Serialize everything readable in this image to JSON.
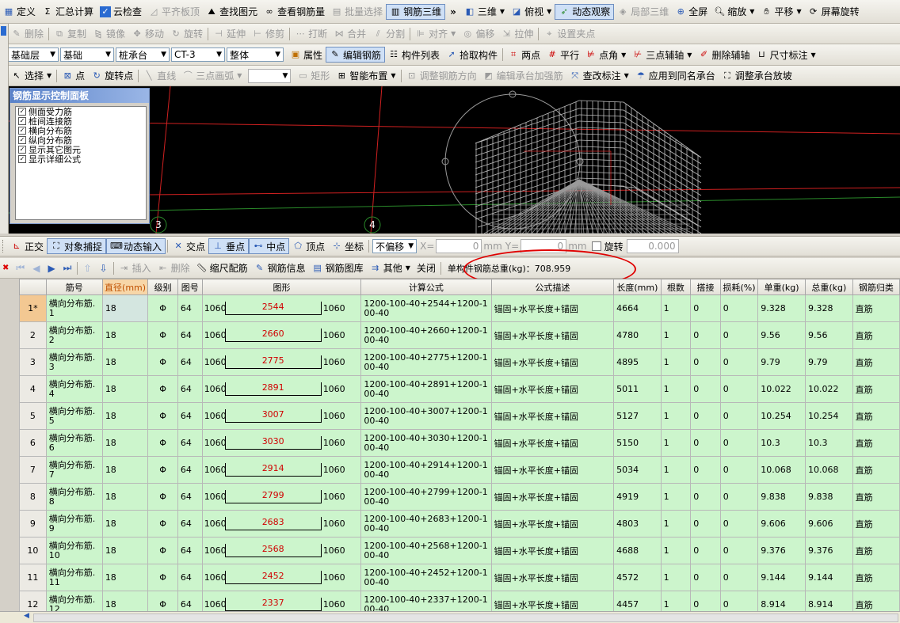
{
  "menu": {
    "items": [
      "定义",
      "汇总计算",
      "云检查",
      "平齐板顶",
      "查找图元",
      "查看钢筋量",
      "批量选择",
      "钢筋三维",
      "三维",
      "俯视",
      "动态观察",
      "局部三维",
      "全屏",
      "缩放",
      "平移",
      "屏幕旋转"
    ]
  },
  "edit_toolbar": {
    "items": [
      "删除",
      "复制",
      "镜像",
      "移动",
      "旋转",
      "延伸",
      "修剪",
      "打断",
      "合并",
      "分割",
      "对齐",
      "偏移",
      "拉伸",
      "设置夹点"
    ]
  },
  "props_toolbar": {
    "layer": "基础层",
    "category": "基础",
    "type": "桩承台",
    "element": "CT-3",
    "scope": "整体",
    "items": [
      "属性",
      "编辑钢筋",
      "构件列表",
      "拾取构件",
      "两点",
      "平行",
      "点角",
      "三点辅轴",
      "删除辅轴",
      "尺寸标注"
    ]
  },
  "draw_toolbar": {
    "items": [
      "选择",
      "点",
      "旋转点",
      "直线",
      "三点画弧",
      "矩形",
      "智能布置",
      "调整钢筋方向",
      "编辑承台加强筋",
      "查改标注",
      "应用到同名承台",
      "调整承台放坡"
    ]
  },
  "rebar_panel": {
    "title": "钢筋显示控制面板",
    "options": [
      "侧面受力筋",
      "桩间连接筋",
      "横向分布筋",
      "纵向分布筋",
      "显示其它图元",
      "显示详细公式"
    ]
  },
  "viewport": {
    "axis_labels": [
      "3",
      "4"
    ]
  },
  "snap_toolbar": {
    "items": [
      "正交",
      "对象捕捉",
      "动态输入",
      "交点",
      "垂点",
      "中点",
      "顶点",
      "坐标"
    ],
    "offset_mode": "不偏移",
    "x_label": "X=",
    "x_value": "0",
    "y_label": "Y=",
    "y_value": "0",
    "unit": "mm",
    "rotate_label": "旋转",
    "rotate_value": "0.000"
  },
  "grid_toolbar": {
    "items": [
      "插入",
      "删除",
      "缩尺配筋",
      "钢筋信息",
      "钢筋图库",
      "其他",
      "关闭"
    ],
    "total_weight_label": "单构件钢筋总重(kg)：708.959"
  },
  "table": {
    "columns": [
      "筋号",
      "直径(mm)",
      "级别",
      "图号",
      "图形",
      "计算公式",
      "公式描述",
      "长度(mm)",
      "根数",
      "搭接",
      "损耗(%)",
      "单重(kg)",
      "总重(kg)",
      "钢筋归类"
    ],
    "rows": [
      {
        "no": "1*",
        "name": "横向分布筋.1",
        "dia": "18",
        "grade": "Φ",
        "fig": "64",
        "left": "1060",
        "mid": "2544",
        "right": "1060",
        "formula": "1200-100-40+2544+1200-100-40",
        "desc": "锚固+水平长度+锚固",
        "len": "4664",
        "count": "1",
        "lap": "0",
        "loss": "0",
        "unit_w": "9.328",
        "total_w": "9.328",
        "cls": "直筋"
      },
      {
        "no": "2",
        "name": "横向分布筋.2",
        "dia": "18",
        "grade": "Φ",
        "fig": "64",
        "left": "1060",
        "mid": "2660",
        "right": "1060",
        "formula": "1200-100-40+2660+1200-100-40",
        "desc": "锚固+水平长度+锚固",
        "len": "4780",
        "count": "1",
        "lap": "0",
        "loss": "0",
        "unit_w": "9.56",
        "total_w": "9.56",
        "cls": "直筋"
      },
      {
        "no": "3",
        "name": "横向分布筋.3",
        "dia": "18",
        "grade": "Φ",
        "fig": "64",
        "left": "1060",
        "mid": "2775",
        "right": "1060",
        "formula": "1200-100-40+2775+1200-100-40",
        "desc": "锚固+水平长度+锚固",
        "len": "4895",
        "count": "1",
        "lap": "0",
        "loss": "0",
        "unit_w": "9.79",
        "total_w": "9.79",
        "cls": "直筋"
      },
      {
        "no": "4",
        "name": "横向分布筋.4",
        "dia": "18",
        "grade": "Φ",
        "fig": "64",
        "left": "1060",
        "mid": "2891",
        "right": "1060",
        "formula": "1200-100-40+2891+1200-100-40",
        "desc": "锚固+水平长度+锚固",
        "len": "5011",
        "count": "1",
        "lap": "0",
        "loss": "0",
        "unit_w": "10.022",
        "total_w": "10.022",
        "cls": "直筋"
      },
      {
        "no": "5",
        "name": "横向分布筋.5",
        "dia": "18",
        "grade": "Φ",
        "fig": "64",
        "left": "1060",
        "mid": "3007",
        "right": "1060",
        "formula": "1200-100-40+3007+1200-100-40",
        "desc": "锚固+水平长度+锚固",
        "len": "5127",
        "count": "1",
        "lap": "0",
        "loss": "0",
        "unit_w": "10.254",
        "total_w": "10.254",
        "cls": "直筋"
      },
      {
        "no": "6",
        "name": "横向分布筋.6",
        "dia": "18",
        "grade": "Φ",
        "fig": "64",
        "left": "1060",
        "mid": "3030",
        "right": "1060",
        "formula": "1200-100-40+3030+1200-100-40",
        "desc": "锚固+水平长度+锚固",
        "len": "5150",
        "count": "1",
        "lap": "0",
        "loss": "0",
        "unit_w": "10.3",
        "total_w": "10.3",
        "cls": "直筋"
      },
      {
        "no": "7",
        "name": "横向分布筋.7",
        "dia": "18",
        "grade": "Φ",
        "fig": "64",
        "left": "1060",
        "mid": "2914",
        "right": "1060",
        "formula": "1200-100-40+2914+1200-100-40",
        "desc": "锚固+水平长度+锚固",
        "len": "5034",
        "count": "1",
        "lap": "0",
        "loss": "0",
        "unit_w": "10.068",
        "total_w": "10.068",
        "cls": "直筋"
      },
      {
        "no": "8",
        "name": "横向分布筋.8",
        "dia": "18",
        "grade": "Φ",
        "fig": "64",
        "left": "1060",
        "mid": "2799",
        "right": "1060",
        "formula": "1200-100-40+2799+1200-100-40",
        "desc": "锚固+水平长度+锚固",
        "len": "4919",
        "count": "1",
        "lap": "0",
        "loss": "0",
        "unit_w": "9.838",
        "total_w": "9.838",
        "cls": "直筋"
      },
      {
        "no": "9",
        "name": "横向分布筋.9",
        "dia": "18",
        "grade": "Φ",
        "fig": "64",
        "left": "1060",
        "mid": "2683",
        "right": "1060",
        "formula": "1200-100-40+2683+1200-100-40",
        "desc": "锚固+水平长度+锚固",
        "len": "4803",
        "count": "1",
        "lap": "0",
        "loss": "0",
        "unit_w": "9.606",
        "total_w": "9.606",
        "cls": "直筋"
      },
      {
        "no": "10",
        "name": "横向分布筋.10",
        "dia": "18",
        "grade": "Φ",
        "fig": "64",
        "left": "1060",
        "mid": "2568",
        "right": "1060",
        "formula": "1200-100-40+2568+1200-100-40",
        "desc": "锚固+水平长度+锚固",
        "len": "4688",
        "count": "1",
        "lap": "0",
        "loss": "0",
        "unit_w": "9.376",
        "total_w": "9.376",
        "cls": "直筋"
      },
      {
        "no": "11",
        "name": "横向分布筋.11",
        "dia": "18",
        "grade": "Φ",
        "fig": "64",
        "left": "1060",
        "mid": "2452",
        "right": "1060",
        "formula": "1200-100-40+2452+1200-100-40",
        "desc": "锚固+水平长度+锚固",
        "len": "4572",
        "count": "1",
        "lap": "0",
        "loss": "0",
        "unit_w": "9.144",
        "total_w": "9.144",
        "cls": "直筋"
      },
      {
        "no": "12",
        "name": "横向分布筋.12",
        "dia": "18",
        "grade": "Φ",
        "fig": "64",
        "left": "1060",
        "mid": "2337",
        "right": "1060",
        "formula": "1200-100-40+2337+1200-100-40",
        "desc": "锚固+水平长度+锚固",
        "len": "4457",
        "count": "1",
        "lap": "0",
        "loss": "0",
        "unit_w": "8.914",
        "total_w": "8.914",
        "cls": "直筋"
      }
    ]
  },
  "colors": {
    "row_bg": "#ccf5cc",
    "highlight_circle": "#e00000",
    "shape_dimension": "#d00000",
    "viewport_bg": "#000000"
  }
}
